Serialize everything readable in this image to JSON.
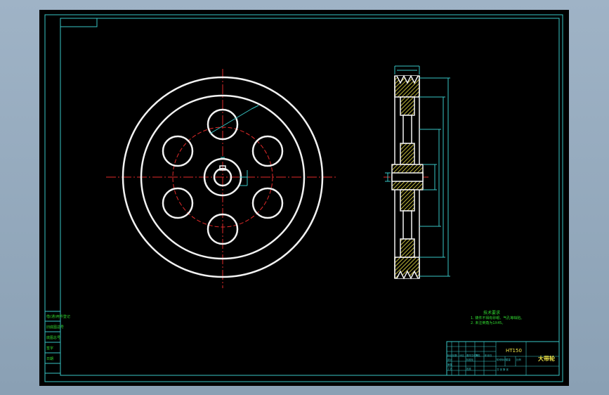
{
  "drawing": {
    "part_name": "大带轮",
    "material": "HT150",
    "tech_requirements": {
      "title": "技术要求",
      "items": [
        "1. 铸件不得有砂眼、气孔等缺陷。",
        "2. 未注倒角为1X45。"
      ]
    },
    "left_stamp_labels": [
      "借(通)用件登记",
      "旧底图总号",
      "底图总号",
      "签字",
      "日期"
    ],
    "title_block": {
      "row_labels": [
        "标记",
        "处数",
        "分区",
        "更改文件号",
        "签名",
        "年月日"
      ],
      "role_labels": [
        "设计",
        "标准化",
        "审核",
        "工艺",
        "批准"
      ],
      "stage_labels": [
        "阶段标记",
        "重量",
        "比例"
      ],
      "sheet_label": "共 张 第 张"
    }
  },
  "colors": {
    "frame": "#39c6c6",
    "outline": "#f2f2f2",
    "centerline": "#e12a2a",
    "hatch": "#f2e84a",
    "annotation": "#32dd32"
  }
}
